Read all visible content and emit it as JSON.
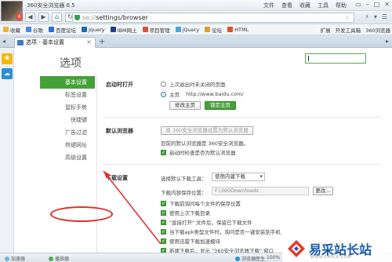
{
  "window": {
    "title": "360安全浏览器 6.5",
    "avatar_badge": "4",
    "menu": [
      "文件",
      "查看",
      "收藏",
      "工具",
      "帮助"
    ],
    "controls": [
      "▭",
      "–",
      "□",
      "✕"
    ]
  },
  "address_bar": {
    "scheme": "se://",
    "path": "settings/browser",
    "right_icons": [
      "⚡",
      "▾",
      "☰"
    ]
  },
  "bookmarks": {
    "items": [
      "收藏",
      "谷歌",
      "百度论坛",
      "jquery",
      "IBM网上",
      "项目管理",
      "jQuery",
      "论坛",
      "HTML"
    ],
    "right": [
      "扩展",
      "开发工具箱",
      "360浏览器"
    ]
  },
  "tab": {
    "label": "选项 - 基本设置"
  },
  "page": {
    "title": "选项",
    "nav": [
      {
        "label": "基本设置",
        "active": true
      },
      {
        "label": "标签设置",
        "active": false
      },
      {
        "label": "鼠标手势",
        "active": false
      },
      {
        "label": "快捷键",
        "active": false
      },
      {
        "label": "广告过滤",
        "active": false
      },
      {
        "label": "热键网址",
        "active": false
      },
      {
        "label": "高级设置",
        "active": false
      }
    ],
    "startup": {
      "heading": "启动时打开",
      "option_last": "上次退出时未关闭的页面",
      "option_home": "主页",
      "home_url": "http://www.baidu.com/",
      "btn_edit": "修改主页",
      "btn_lock": "锁定主页"
    },
    "default_browser": {
      "heading": "默认浏览器",
      "btn_set": "将 360安全浏览器设置为默认浏览器",
      "status": "目前的默认浏览器是 360安全浏览器。",
      "check_on_start": "启动时检查是否为默认浏览器"
    },
    "download": {
      "heading": "下载设置",
      "tool_label": "选择默认下载工具：",
      "tool_value": "使用内建下载",
      "path_label": "下载内容保存位置：",
      "path_value": "F:\\360Downloads",
      "btn_change": "更改...",
      "options": [
        "下载前询问每个文件的保存位置",
        "使用上次下载目录",
        "\"直接打开\" 文件后，保留已下载文件",
        "当下载apk类型文件时，询问是否一键安装到手机",
        "使用迅雷下载加速模块",
        "新建下载后，显示 \"360安全浏览器下载\" 窗口"
      ]
    }
  },
  "statusbar": {
    "left": "加速器",
    "play": "播放器",
    "right": [
      "浏览器医生",
      "100%"
    ]
  },
  "watermark": {
    "text": "易采站长站",
    "small": "WWW.EASCK.COM"
  }
}
